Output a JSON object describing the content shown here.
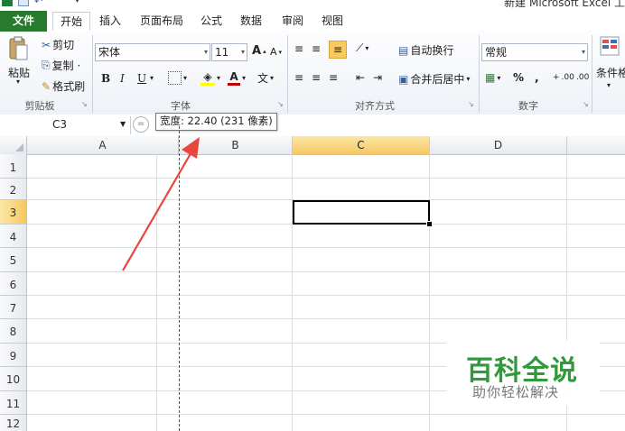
{
  "window": {
    "title": "新建 Microsoft Excel 工",
    "qat_icons": [
      "excel-icon",
      "save-icon",
      "undo-icon",
      "qat-dropdown-icon"
    ]
  },
  "tabs": [
    {
      "label": "文件",
      "active": false
    },
    {
      "label": "开始",
      "active": true
    },
    {
      "label": "插入",
      "active": false
    },
    {
      "label": "页面布局",
      "active": false
    },
    {
      "label": "公式",
      "active": false
    },
    {
      "label": "数据",
      "active": false
    },
    {
      "label": "审阅",
      "active": false
    },
    {
      "label": "视图",
      "active": false
    }
  ],
  "ribbon": {
    "clipboard": {
      "paste": "粘贴",
      "cut": "剪切",
      "copy": "复制 ·",
      "format_painter": "格式刷",
      "label": "剪贴板"
    },
    "font": {
      "name": "宋体",
      "size": "11",
      "grow": "A",
      "shrink": "A",
      "bold": "B",
      "italic": "I",
      "underline": "U",
      "phonetic": "文",
      "label": "字体",
      "font_color": "#c00000",
      "fill_color": "#ffff00"
    },
    "alignment": {
      "wrap_text": "自动换行",
      "merge_center": "合并后居中",
      "label": "对齐方式"
    },
    "number": {
      "format": "常规",
      "percent": "%",
      "comma": ",",
      "inc_decimal": ".00",
      "dec_decimal": ".00",
      "label": "数字"
    },
    "styles": {
      "conditional": "条件格"
    }
  },
  "formula_bar": {
    "name_box": "C3",
    "fx": "=",
    "tooltip": "宽度: 22.40 (231 像素)"
  },
  "grid": {
    "columns": [
      "A",
      "B",
      "C",
      "D"
    ],
    "selected_column": "C",
    "rows": [
      "1",
      "2",
      "3",
      "4",
      "5",
      "6",
      "7",
      "8",
      "9",
      "10",
      "11",
      "12"
    ],
    "selected_row": "3",
    "accent": "#f6c862"
  },
  "annotation": {
    "arrow_color": "#e8453c"
  },
  "watermark": {
    "title": "百科全说",
    "subtitle": "助你轻松解决",
    "color": "#2f9a3a"
  }
}
